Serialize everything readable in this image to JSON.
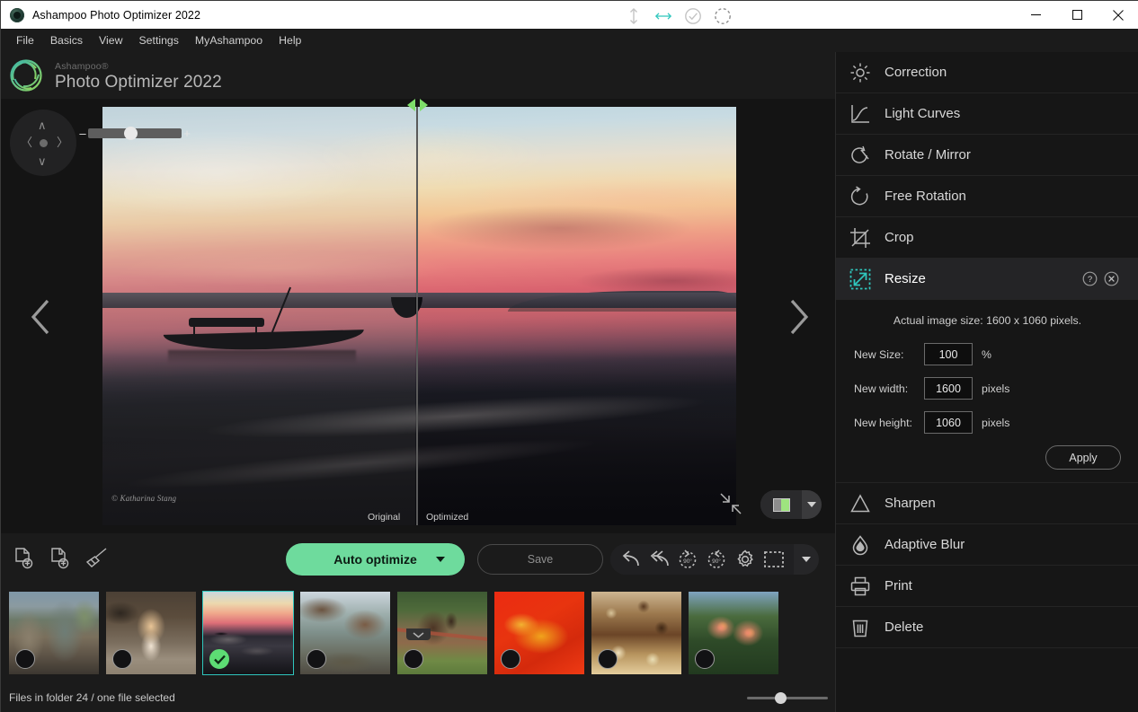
{
  "window": {
    "title": "Ashampoo Photo Optimizer 2022",
    "app_icon": "ashampoo-logo-icon",
    "minimize_label": "—",
    "maximize_label": "□",
    "close_label": "✕"
  },
  "menubar": {
    "items": [
      {
        "label": "File"
      },
      {
        "label": "Basics"
      },
      {
        "label": "View"
      },
      {
        "label": "Settings"
      },
      {
        "label": "MyAshampoo"
      },
      {
        "label": "Help"
      }
    ]
  },
  "brand": {
    "superscript": "Ashampoo®",
    "product": "Photo Optimizer 2022"
  },
  "viewer": {
    "watermark": "© Katharina Stang",
    "compare_labels": {
      "original": "Original",
      "optimized": "Optimized"
    },
    "pan_pad": {
      "up": "∧",
      "down": "∨",
      "left": "〈",
      "right": "〉"
    },
    "zoom_slider": {
      "minus": "–",
      "plus": "+",
      "value": 33
    },
    "prev_label": "‹",
    "next_label": "›",
    "fit_to_window_label": "fit-to-window",
    "compare_mode_label": "side-by-side-compare"
  },
  "actionbar": {
    "file_tools": [
      {
        "name": "open-file-icon"
      },
      {
        "name": "open-folder-icon"
      },
      {
        "name": "clean-brush-icon"
      }
    ],
    "auto_optimize_label": "Auto optimize",
    "save_label": "Save",
    "edit_tools": [
      {
        "name": "undo-icon",
        "label": "Undo"
      },
      {
        "name": "undo-all-icon",
        "label": "Undo all"
      },
      {
        "name": "rotate-left-90-icon",
        "label": "90°"
      },
      {
        "name": "rotate-right-90-icon",
        "label": "90°"
      },
      {
        "name": "settings-gear-icon",
        "label": "Settings"
      },
      {
        "name": "selection-marquee-icon",
        "label": "Select"
      }
    ]
  },
  "filmstrip": {
    "thumbnails": [
      {
        "name": "thumb-temple-ruins",
        "selected": false,
        "processed": false
      },
      {
        "name": "thumb-ginger-cat",
        "selected": false,
        "processed": false
      },
      {
        "name": "thumb-sunset-boat",
        "selected": true,
        "processed": true
      },
      {
        "name": "thumb-tree-bird",
        "selected": false,
        "processed": false
      },
      {
        "name": "thumb-horse-fence",
        "selected": false,
        "processed": false
      },
      {
        "name": "thumb-orange-butterfly",
        "selected": false,
        "processed": false
      },
      {
        "name": "thumb-market-nuts",
        "selected": false,
        "processed": false
      },
      {
        "name": "thumb-pink-flowers",
        "selected": false,
        "processed": false
      }
    ]
  },
  "right_panel": {
    "tools_top": [
      {
        "label": "Correction",
        "icon": "sun-brightness-icon",
        "active": false
      },
      {
        "label": "Light Curves",
        "icon": "curve-graph-icon",
        "active": false
      },
      {
        "label": "Rotate / Mirror",
        "icon": "rotate-mirror-icon",
        "active": false
      },
      {
        "label": "Free Rotation",
        "icon": "free-rotation-icon",
        "active": false
      },
      {
        "label": "Crop",
        "icon": "crop-icon",
        "active": false
      },
      {
        "label": "Resize",
        "icon": "resize-arrow-icon",
        "active": true
      }
    ],
    "tools_bottom": [
      {
        "label": "Sharpen",
        "icon": "triangle-sharpen-icon"
      },
      {
        "label": "Adaptive Blur",
        "icon": "water-drop-icon"
      },
      {
        "label": "Print",
        "icon": "printer-icon"
      },
      {
        "label": "Delete",
        "icon": "trash-icon"
      }
    ],
    "row_actions": {
      "help": "?",
      "close": "✕"
    },
    "resize": {
      "actual_size_text": "Actual image size: 1600 x 1060 pixels.",
      "fields": [
        {
          "label": "New Size:",
          "value": "100",
          "unit": "%"
        },
        {
          "label": "New width:",
          "value": "1600",
          "unit": "pixels"
        },
        {
          "label": "New height:",
          "value": "1060",
          "unit": "pixels"
        }
      ],
      "apply_label": "Apply"
    }
  },
  "statusbar": {
    "text": "Files in folder 24 / one file selected",
    "icons": [
      {
        "name": "fit-height-icon",
        "active": false
      },
      {
        "name": "fit-width-icon",
        "active": true
      },
      {
        "name": "check-circle-icon",
        "active": false
      },
      {
        "name": "pending-circle-icon",
        "active": false
      }
    ],
    "thumb_size_slider": {
      "value": 35
    }
  },
  "colors": {
    "accent_green": "#6edb9d",
    "accent_teal": "#2fc6bd",
    "panel_bg": "#161616",
    "app_bg": "#1b1b1b"
  }
}
